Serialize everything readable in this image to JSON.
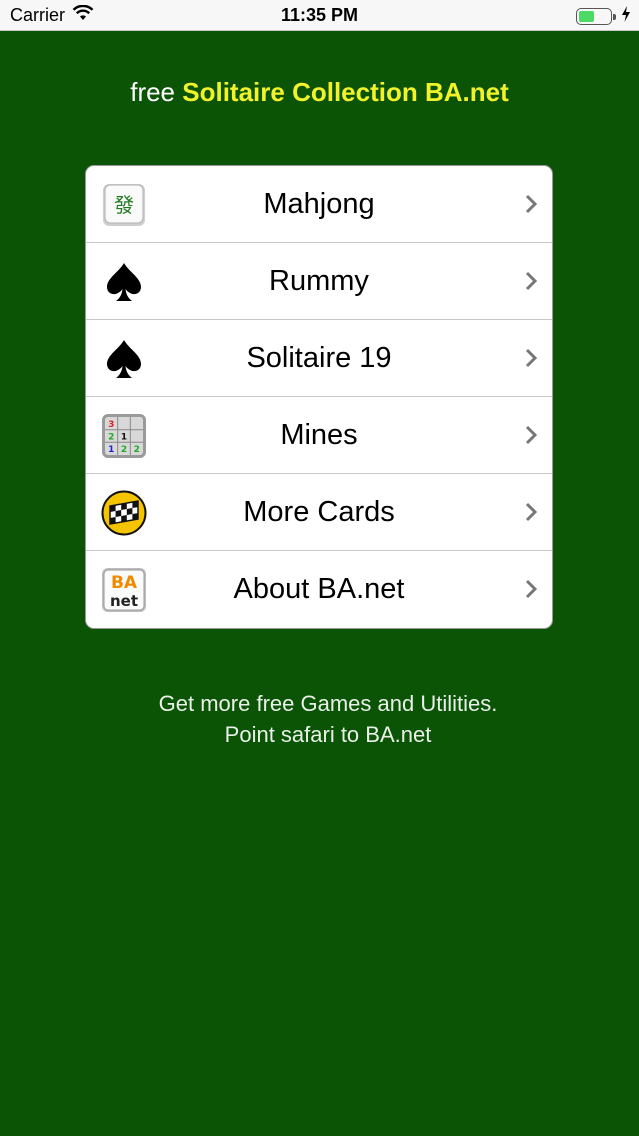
{
  "status_bar": {
    "carrier": "Carrier",
    "time": "11:35 PM",
    "battery_level": 0.5
  },
  "headline": {
    "prefix": "free",
    "title": "Solitaire Collection BA.net"
  },
  "menu": {
    "items": [
      {
        "label": "Mahjong",
        "icon": "mahjong-tile-icon"
      },
      {
        "label": "Rummy",
        "icon": "spade-icon"
      },
      {
        "label": "Solitaire 19",
        "icon": "spade-icon"
      },
      {
        "label": "Mines",
        "icon": "minesweeper-grid-icon"
      },
      {
        "label": "More Cards",
        "icon": "checkered-flag-icon"
      },
      {
        "label": "About BA.net",
        "icon": "ba-net-logo-icon"
      }
    ]
  },
  "footer": {
    "line1": "Get more free Games and Utilities.",
    "line2": "Point safari to BA.net"
  },
  "colors": {
    "background": "#0b5406",
    "headline_accent": "#f2f22b",
    "battery": "#4cd964"
  }
}
